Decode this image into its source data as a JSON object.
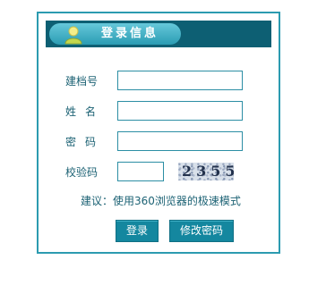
{
  "header": {
    "title": "登录信息",
    "icon": "user-icon"
  },
  "form": {
    "archive_label": "建档号",
    "archive_value": "",
    "name_label": "姓名",
    "name_value": "",
    "password_label": "密码",
    "password_value": "",
    "captcha_label": "校验码",
    "captcha_value": "",
    "captcha_image_text": "2355"
  },
  "hint": "建议：使用360浏览器的极速模式",
  "buttons": {
    "login": "登录",
    "change_password": "修改密码"
  },
  "colors": {
    "border": "#2c9bb0",
    "header_bg": "#0d5f73",
    "label_text": "#1c6274",
    "button_bg": "#14879f"
  }
}
